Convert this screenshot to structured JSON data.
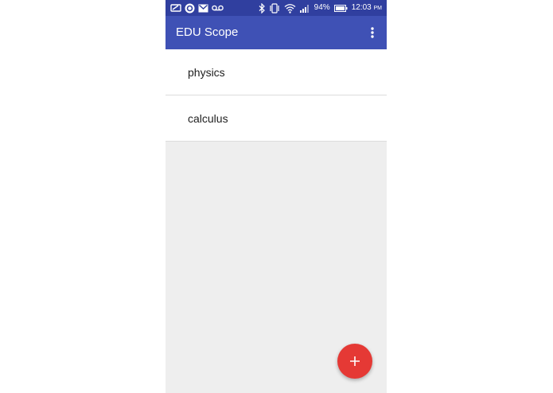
{
  "status_bar": {
    "battery_percent": "94%",
    "time": "12:03",
    "ampm": "PM",
    "left_icons": [
      "screenshot-icon",
      "app-notification-icon",
      "gmail-icon",
      "voicemail-icon"
    ],
    "right_icons": [
      "bluetooth-icon",
      "vibrate-icon",
      "wifi-icon",
      "cellular-signal-icon",
      "battery-icon"
    ]
  },
  "app_bar": {
    "title": "EDU Scope",
    "menu_icon": "more-vert-icon"
  },
  "list": {
    "items": [
      {
        "label": "physics"
      },
      {
        "label": "calculus"
      }
    ]
  },
  "fab": {
    "icon": "plus-icon"
  },
  "colors": {
    "status_bar": "#303f9f",
    "app_bar": "#3f51b5",
    "background": "#eeeeee",
    "fab": "#e53935",
    "list_background": "#ffffff"
  }
}
